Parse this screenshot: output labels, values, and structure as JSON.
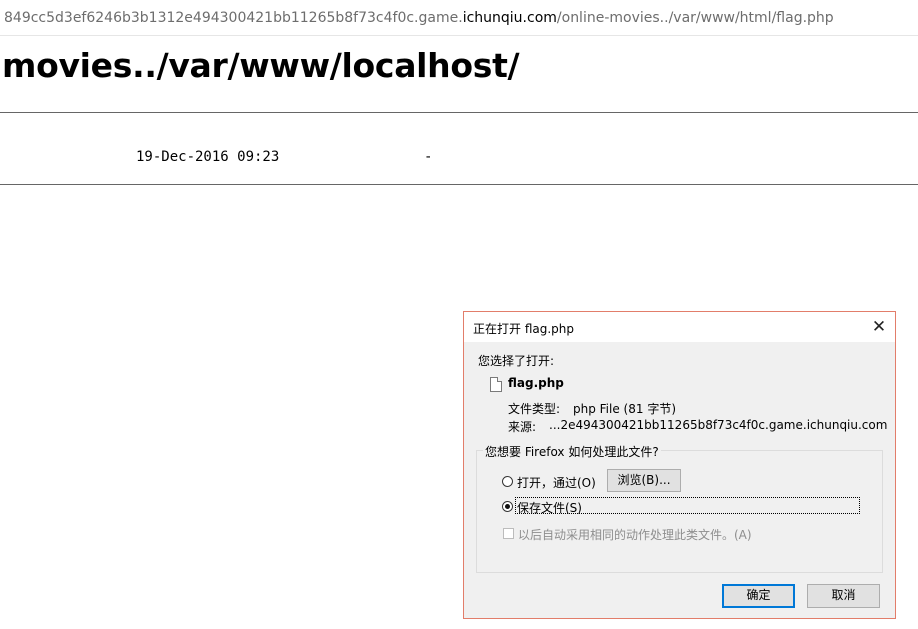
{
  "browser": {
    "url_prefix": "849cc5d3ef6246b3b1312e494300421bb11265b8f73c4f0c.game.",
    "url_host": "ichunqiu.com",
    "url_path": "/online-movies../var/www/html/flag.php"
  },
  "page": {
    "heading": "movies../var/www/localhost/",
    "listing": {
      "date": "19-Dec-2016 09:23",
      "size": "-"
    }
  },
  "dialog": {
    "title": "正在打开 flag.php",
    "close_glyph": "✕",
    "intro": "您选择了打开:",
    "file_name": "flag.php",
    "type_label": "文件类型:",
    "type_value": "php File (81 字节)",
    "source_label": "来源:",
    "source_value": "...2e494300421bb11265b8f73c4f0c.game.ichunqiu.com",
    "group_label": "您想要 Firefox 如何处理此文件?",
    "option_open": "打开，通过(O)",
    "browse_button": "浏览(B)...",
    "option_save": "保存文件(S)",
    "remember_label": "以后自动采用相同的动作处理此类文件。(A)",
    "ok_button": "确定",
    "cancel_button": "取消",
    "selected_option": "save"
  },
  "icons": {
    "close": "close-icon",
    "file": "file-icon"
  },
  "colors": {
    "dialog_border": "#e27d6a",
    "default_button_border": "#0078d7"
  }
}
